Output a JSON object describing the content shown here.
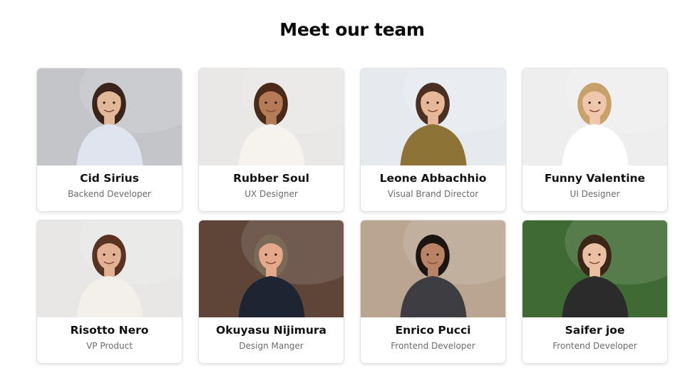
{
  "page": {
    "title": "Meet our team"
  },
  "team": [
    {
      "name": "Cid Sirius",
      "role": "Backend Developer",
      "photo": {
        "bg": "#c3c5c9",
        "skin": "#e2b89a",
        "hair": "#3a2419",
        "shirt": "#dfe4ee",
        "icon": "person-photo-icon"
      }
    },
    {
      "name": "Rubber Soul",
      "role": "UX Designer",
      "photo": {
        "bg": "#e9e8e6",
        "skin": "#b57a56",
        "hair": "#4a2a18",
        "shirt": "#f6f3ee",
        "icon": "person-photo-icon"
      }
    },
    {
      "name": "Leone Abbachhio",
      "role": "Visual Brand Director",
      "photo": {
        "bg": "#e6eaef",
        "skin": "#e7b898",
        "hair": "#4a2f22",
        "shirt": "#8d7436",
        "icon": "person-photo-icon"
      }
    },
    {
      "name": "Funny Valentine",
      "role": "UI Designer",
      "photo": {
        "bg": "#eeeeef",
        "skin": "#efc7aa",
        "hair": "#c8a06a",
        "shirt": "#ffffff",
        "icon": "person-photo-icon"
      }
    },
    {
      "name": "Risotto Nero",
      "role": "VP Product",
      "photo": {
        "bg": "#e8e7e6",
        "skin": "#e2b193",
        "hair": "#5a3222",
        "shirt": "#f3efea",
        "icon": "person-photo-icon"
      }
    },
    {
      "name": "Okuyasu Nijimura",
      "role": "Design Manger",
      "photo": {
        "bg": "#5e4538",
        "skin": "#e3a98a",
        "hair": "#7a6a55",
        "shirt": "#1f2433",
        "icon": "person-photo-icon"
      }
    },
    {
      "name": "Enrico Pucci",
      "role": "Frontend Developer",
      "photo": {
        "bg": "#b9a590",
        "skin": "#b98466",
        "hair": "#1b1612",
        "shirt": "#3d3d42",
        "icon": "person-photo-icon"
      }
    },
    {
      "name": "Saifer joe",
      "role": "Frontend Developer",
      "photo": {
        "bg": "#3f6a33",
        "skin": "#e9c0a2",
        "hair": "#3b2618",
        "shirt": "#2b2b2b",
        "icon": "person-photo-icon"
      }
    }
  ]
}
